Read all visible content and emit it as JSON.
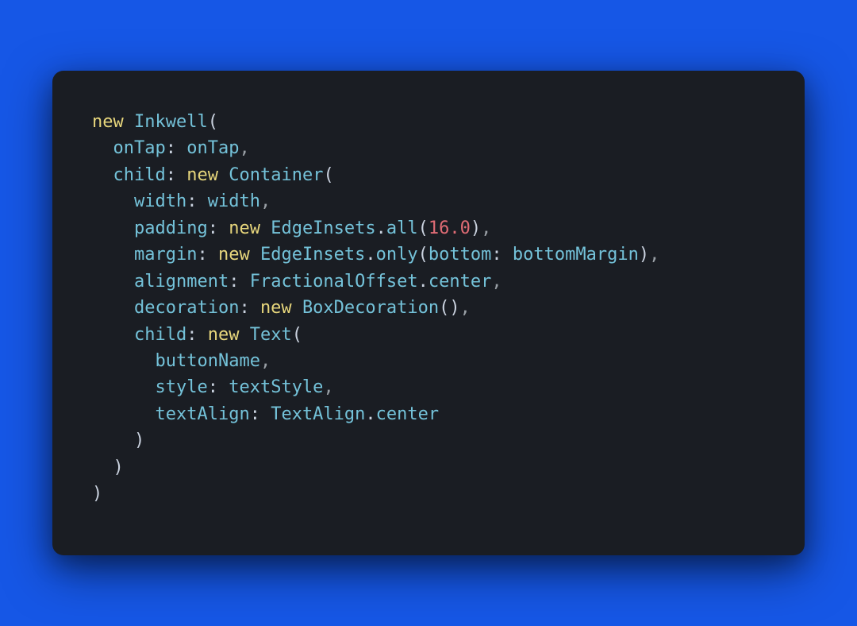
{
  "code": {
    "tokens": [
      {
        "kw": "new"
      },
      {
        "sp": " "
      },
      {
        "id": "Inkwell"
      },
      {
        "p": "("
      },
      {
        "nl": true
      },
      {
        "sp": "  "
      },
      {
        "id": "onTap"
      },
      {
        "p": ":"
      },
      {
        "sp": " "
      },
      {
        "id": "onTap"
      },
      {
        "c": ","
      },
      {
        "nl": true
      },
      {
        "sp": "  "
      },
      {
        "id": "child"
      },
      {
        "p": ":"
      },
      {
        "sp": " "
      },
      {
        "kw": "new"
      },
      {
        "sp": " "
      },
      {
        "id": "Container"
      },
      {
        "p": "("
      },
      {
        "nl": true
      },
      {
        "sp": "    "
      },
      {
        "id": "width"
      },
      {
        "p": ":"
      },
      {
        "sp": " "
      },
      {
        "id": "width"
      },
      {
        "c": ","
      },
      {
        "nl": true
      },
      {
        "sp": "    "
      },
      {
        "id": "padding"
      },
      {
        "p": ":"
      },
      {
        "sp": " "
      },
      {
        "kw": "new"
      },
      {
        "sp": " "
      },
      {
        "id": "EdgeInsets"
      },
      {
        "p": "."
      },
      {
        "id": "all"
      },
      {
        "p": "("
      },
      {
        "num": "16.0"
      },
      {
        "p": ")"
      },
      {
        "c": ","
      },
      {
        "nl": true
      },
      {
        "sp": "    "
      },
      {
        "id": "margin"
      },
      {
        "p": ":"
      },
      {
        "sp": " "
      },
      {
        "kw": "new"
      },
      {
        "sp": " "
      },
      {
        "id": "EdgeInsets"
      },
      {
        "p": "."
      },
      {
        "id": "only"
      },
      {
        "p": "("
      },
      {
        "id": "bottom"
      },
      {
        "p": ":"
      },
      {
        "sp": " "
      },
      {
        "id": "bottomMargin"
      },
      {
        "p": ")"
      },
      {
        "c": ","
      },
      {
        "nl": true
      },
      {
        "sp": "    "
      },
      {
        "id": "alignment"
      },
      {
        "p": ":"
      },
      {
        "sp": " "
      },
      {
        "id": "FractionalOffset"
      },
      {
        "p": "."
      },
      {
        "id": "center"
      },
      {
        "c": ","
      },
      {
        "nl": true
      },
      {
        "sp": "    "
      },
      {
        "id": "decoration"
      },
      {
        "p": ":"
      },
      {
        "sp": " "
      },
      {
        "kw": "new"
      },
      {
        "sp": " "
      },
      {
        "id": "BoxDecoration"
      },
      {
        "p": "()"
      },
      {
        "c": ","
      },
      {
        "nl": true
      },
      {
        "sp": "    "
      },
      {
        "id": "child"
      },
      {
        "p": ":"
      },
      {
        "sp": " "
      },
      {
        "kw": "new"
      },
      {
        "sp": " "
      },
      {
        "id": "Text"
      },
      {
        "p": "("
      },
      {
        "nl": true
      },
      {
        "sp": "      "
      },
      {
        "id": "buttonName"
      },
      {
        "c": ","
      },
      {
        "nl": true
      },
      {
        "sp": "      "
      },
      {
        "id": "style"
      },
      {
        "p": ":"
      },
      {
        "sp": " "
      },
      {
        "id": "textStyle"
      },
      {
        "c": ","
      },
      {
        "nl": true
      },
      {
        "sp": "      "
      },
      {
        "id": "textAlign"
      },
      {
        "p": ":"
      },
      {
        "sp": " "
      },
      {
        "id": "TextAlign"
      },
      {
        "p": "."
      },
      {
        "id": "center"
      },
      {
        "nl": true
      },
      {
        "sp": "    "
      },
      {
        "p": ")"
      },
      {
        "nl": true
      },
      {
        "sp": "  "
      },
      {
        "p": ")"
      },
      {
        "nl": true
      },
      {
        "p": ")"
      }
    ]
  },
  "colors": {
    "background": "#1657e6",
    "card": "#1a1d23",
    "keyword": "#e7d67c",
    "identifier": "#74c2d9",
    "number": "#e06c75",
    "punctuation": "#cad2df"
  }
}
